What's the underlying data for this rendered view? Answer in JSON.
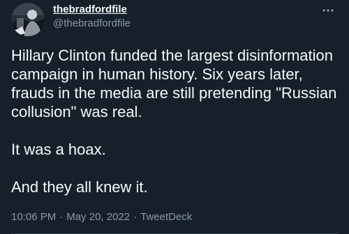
{
  "author": {
    "display_name": "thebradfordfile",
    "handle": "@thebradfordfile",
    "avatar_icon": "profile-photo"
  },
  "more_icon": "more-dots-icon",
  "tweet": {
    "paragraphs": [
      "Hillary Clinton funded the largest disinformation campaign in human history. Six years later, frauds in the media are still pretending \"Russian collusion\" was real.",
      "It was a hoax.",
      "And they all knew it."
    ]
  },
  "meta": {
    "time": "10:06 PM",
    "separator": "·",
    "date": "May 20, 2022",
    "source": "TweetDeck"
  },
  "colors": {
    "background": "#15202b",
    "text": "#f7f9f9",
    "secondary_text": "#8b98a5"
  }
}
